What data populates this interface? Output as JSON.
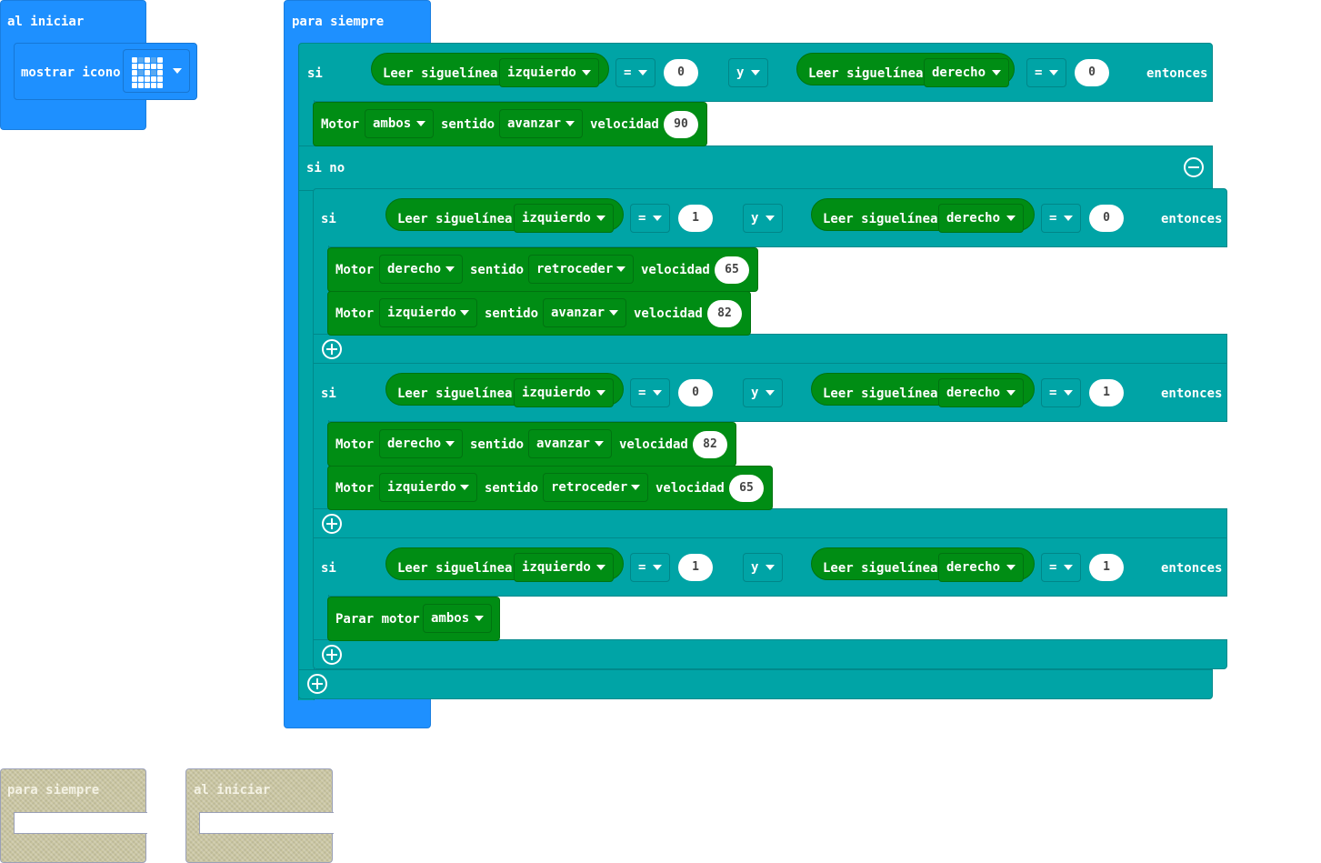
{
  "on_start": {
    "header": "al iniciar",
    "show_icon_label": "mostrar icono",
    "icon_leds": [
      1,
      0,
      1,
      0,
      1,
      1,
      1,
      1,
      1,
      1,
      1,
      0,
      1,
      0,
      1,
      1,
      1,
      1,
      1,
      1,
      1,
      1,
      1,
      1,
      1
    ]
  },
  "forever": {
    "header": "para siempre",
    "if_label": "si",
    "else_label": "si no",
    "then_label": "entonces",
    "and_label": "y",
    "read_label": "Leer siguelínea",
    "motor_label": "Motor",
    "direction_label": "sentido",
    "speed_label": "velocidad",
    "stop_label": "Parar motor",
    "operator": "=",
    "main_if": {
      "left_sensor": "izquierdo",
      "left_value": "0",
      "right_sensor": "derecho",
      "right_value": "0",
      "motor": {
        "side": "ambos",
        "direction": "avanzar",
        "speed": "90"
      }
    },
    "branch1": {
      "left_sensor": "izquierdo",
      "left_value": "1",
      "right_sensor": "derecho",
      "right_value": "0",
      "motor1": {
        "side": "derecho",
        "direction": "retroceder",
        "speed": "65"
      },
      "motor2": {
        "side": "izquierdo",
        "direction": "avanzar",
        "speed": "82"
      }
    },
    "branch2": {
      "left_sensor": "izquierdo",
      "left_value": "0",
      "right_sensor": "derecho",
      "right_value": "1",
      "motor1": {
        "side": "derecho",
        "direction": "avanzar",
        "speed": "82"
      },
      "motor2": {
        "side": "izquierdo",
        "direction": "retroceder",
        "speed": "65"
      }
    },
    "branch3": {
      "left_sensor": "izquierdo",
      "left_value": "1",
      "right_sensor": "derecho",
      "right_value": "1",
      "stop_side": "ambos"
    }
  },
  "ghosts": {
    "forever_header": "para siempre",
    "on_start_header": "al iniciar"
  },
  "colors": {
    "event_blue": "#1e90ff",
    "logic_teal": "#00a4a6",
    "motor_green": "#008d14",
    "disabled_khaki": "#c9c5a0"
  }
}
